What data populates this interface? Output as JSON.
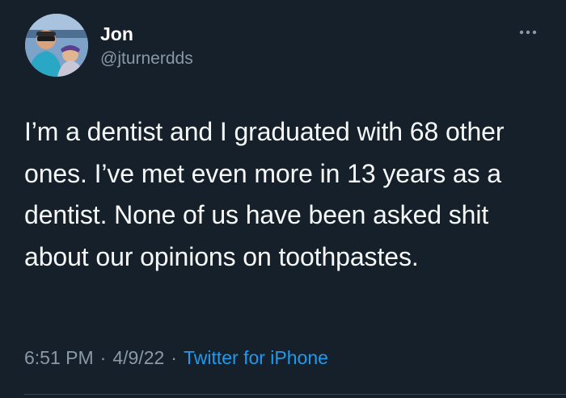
{
  "author": {
    "display_name": "Jon",
    "handle": "@jturnerdds"
  },
  "tweet": {
    "text": "I’m a dentist and I graduated with 68 other ones. I’ve met even more in 13 years as a dentist. None of us have been asked shit about our opinions on toothpastes.",
    "time": "6:51 PM",
    "separator": "·",
    "date": "4/9/22",
    "source": "Twitter for iPhone"
  },
  "icons": {
    "more": "more-horizontal-icon"
  },
  "colors": {
    "background": "#15202b",
    "text_primary": "#f7f9f9",
    "text_secondary": "#8b98a5",
    "link": "#1d9bf0"
  }
}
